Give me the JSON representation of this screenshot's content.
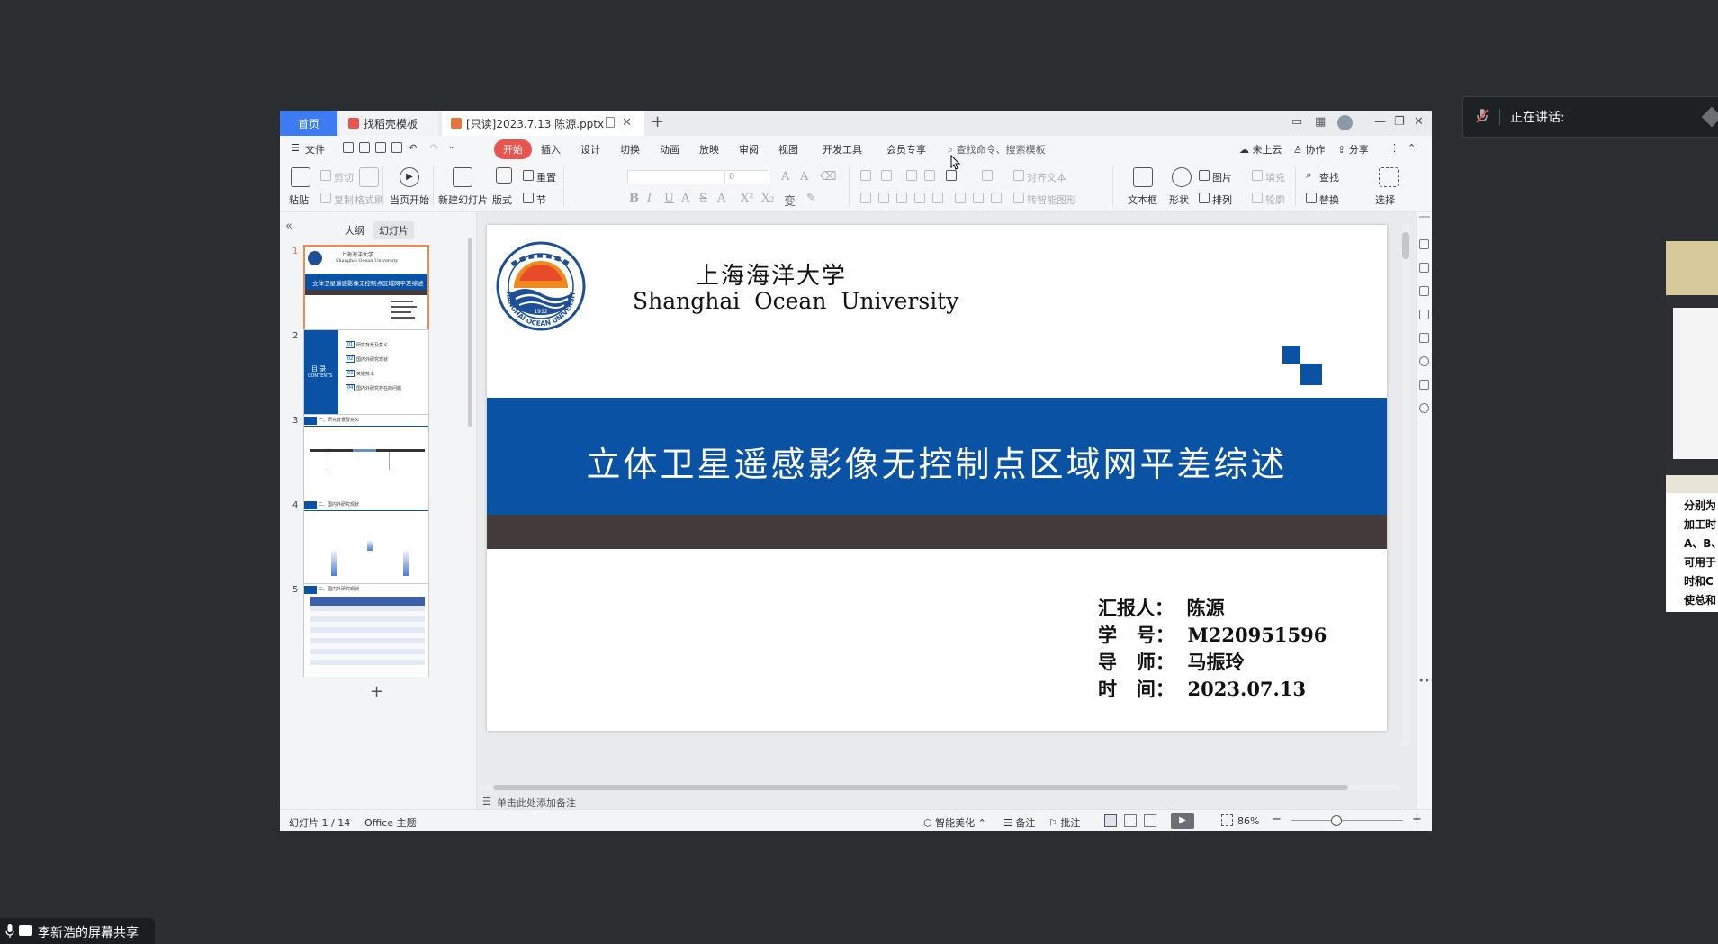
{
  "window": {
    "tabs": [
      {
        "label": "首页"
      },
      {
        "label": "找稻壳模板"
      },
      {
        "label": "[只读]2023.7.13 陈源.pptx"
      }
    ]
  },
  "menubar": {
    "file": "文件",
    "items": [
      "开始",
      "插入",
      "设计",
      "切换",
      "动画",
      "放映",
      "审阅",
      "视图",
      "开发工具",
      "会员专享"
    ],
    "search_placeholder": "查找命令、搜索模板",
    "cloud": "未上云",
    "collab": "协作",
    "share": "分享"
  },
  "ribbon": {
    "paste": "粘贴",
    "cut": "剪切",
    "copy": "复制",
    "format_painter": "格式刷",
    "from_current": "当页开始",
    "new_slide": "新建幻灯片",
    "layout": "版式",
    "reset": "重置",
    "section": "节",
    "font_size": "0",
    "align_text": "对齐文本",
    "convert_smartart": "转智能图形",
    "textbox": "文本框",
    "shape": "形状",
    "picture": "图片",
    "fill": "填充",
    "arrange": "排列",
    "outline": "轮廓",
    "find": "查找",
    "replace": "替换",
    "select": "选择"
  },
  "panel": {
    "tab_outline": "大纲",
    "tab_slides": "幻灯片",
    "thumbs": [
      "1",
      "2",
      "3",
      "4",
      "5"
    ],
    "t1_line1": "上海海洋大学",
    "t1_line2": "Shanghai Ocean University",
    "t1_title": "立体卫星遥感影像无控制点区域网平差综述",
    "t2_title": "目 录",
    "t2_sub": "CONTENTS",
    "t2_items": [
      "研究背景及意义",
      "国内外研究现状",
      "关键技术",
      "国内外研究存在的问题"
    ],
    "t2_nums": [
      "01",
      "02",
      "03",
      "04"
    ],
    "t3_title": "一、研究背景及意义",
    "t4_title": "二、国内外研究现状",
    "t5_title": "二、国内外研究现状"
  },
  "slide": {
    "uni_cn": "上海海洋大学",
    "uni_en": "Shanghai  Ocean  University",
    "logo_year": "1912",
    "logo_text": "SHANGHAI OCEAN UNIVERSITY",
    "title": "立体卫星遥感影像无控制点区域网平差综述",
    "reporter": "汇报人：  陈源",
    "student_id": "学   号：  M220951596",
    "advisor": "导   师：  马振玲",
    "date": "时   间：  2023.07.13",
    "colors": {
      "band": "#0a52a3",
      "strip": "#433b39",
      "accent": "#0a52a3"
    }
  },
  "notes": {
    "placeholder": "单击此处添加备注"
  },
  "status": {
    "slide_count": "幻灯片 1 / 14",
    "theme": "Office 主题",
    "beautify": "智能美化",
    "notes_btn": "备注",
    "comment_btn": "批注",
    "zoom": "86%"
  },
  "overlay": {
    "speaking": "正在讲话:",
    "share": "李新浩的屏幕共享",
    "side_lines": [
      "分别为",
      "加工时",
      "A、B、",
      "可用于",
      "时和C",
      "使总和"
    ]
  }
}
